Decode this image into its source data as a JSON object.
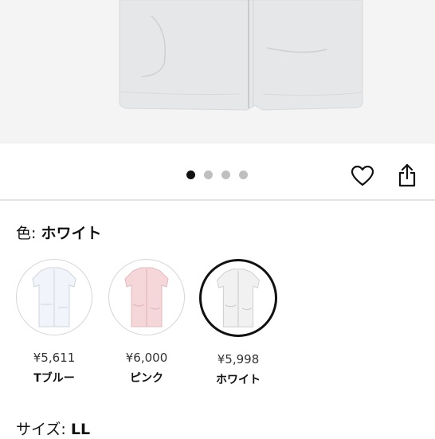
{
  "product": {
    "image_alt_icon": "nurse-uniform-photo",
    "carousel": {
      "count": 4,
      "active": 0
    }
  },
  "actions": {
    "favorite_icon": "heart-icon",
    "share_icon": "share-icon"
  },
  "color": {
    "label": "色: ",
    "selected": "ホワイト"
  },
  "swatches": [
    {
      "price": "¥5,611",
      "name": "Tブルー",
      "tone": "#f2f4fb",
      "selected": false
    },
    {
      "price": "¥6,000",
      "name": "ピンク",
      "tone": "#f6d7d9",
      "selected": false
    },
    {
      "price": "¥5,998",
      "name": "ホワイト",
      "tone": "#f1f1f1",
      "selected": true
    }
  ],
  "size": {
    "label": "サイズ: ",
    "selected": "LL"
  }
}
